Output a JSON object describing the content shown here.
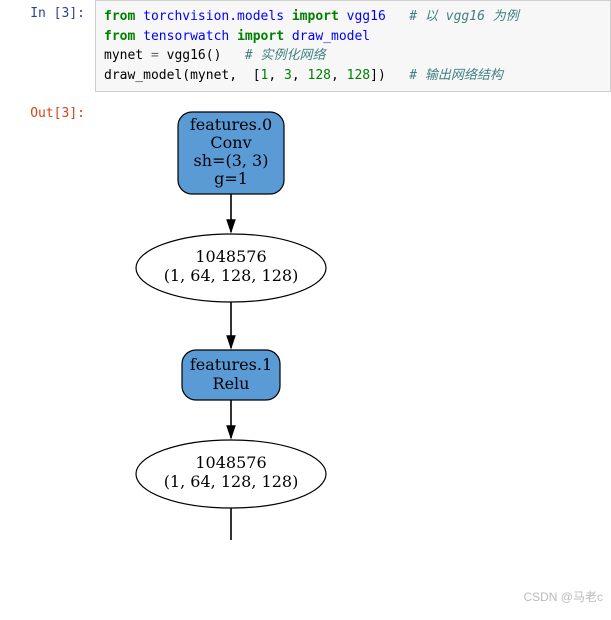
{
  "prompts": {
    "in_label": "In  [3]:",
    "out_label": "Out[3]:"
  },
  "code": {
    "l1": {
      "kw1": "from",
      "mod1": " torchvision.models ",
      "kw2": "import",
      "mod2": " vgg16",
      "sp": "   ",
      "cm": "# 以 vgg16 为例"
    },
    "l2": {
      "kw1": "from",
      "mod1": " tensorwatch ",
      "kw2": "import",
      "mod2": " draw_model"
    },
    "l3": {
      "a": "mynet ",
      "op": "=",
      "b": " vgg16()   ",
      "cm": "# 实例化网络"
    },
    "l4": {
      "a": "draw_model(mynet,  [",
      "n1": "1",
      "c1": ", ",
      "n2": "3",
      "c2": ", ",
      "n3": "128",
      "c3": ", ",
      "n4": "128",
      "b": "])   ",
      "cm": "# 输出网络结构"
    }
  },
  "graph": {
    "n1": {
      "l1": "features.0",
      "l2": "Conv",
      "l3": "sh=(3, 3)",
      "l4": "g=1"
    },
    "e1": {
      "l1": "1048576",
      "l2": "(1, 64, 128, 128)"
    },
    "n2": {
      "l1": "features.1",
      "l2": "Relu"
    },
    "e2": {
      "l1": "1048576",
      "l2": "(1, 64, 128, 128)"
    }
  },
  "watermark": "CSDN @马老c"
}
